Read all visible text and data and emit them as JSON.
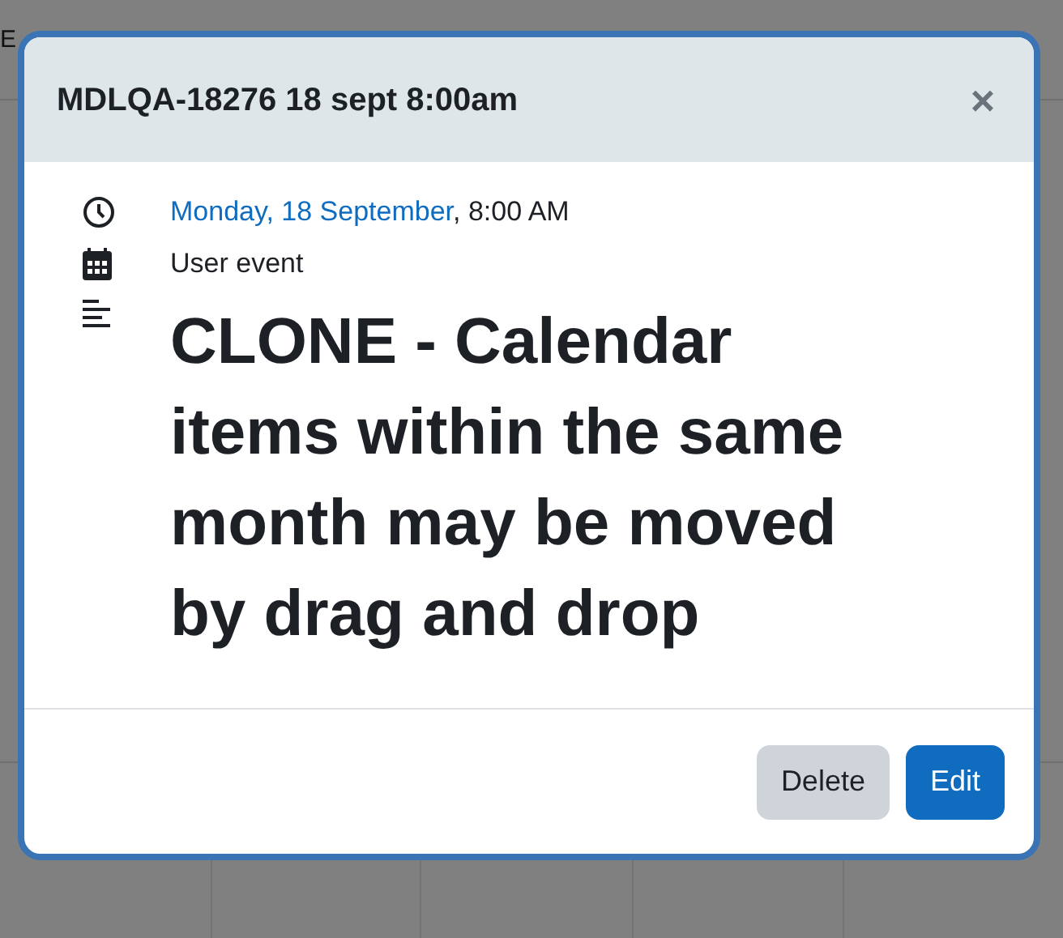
{
  "background": {
    "partial_text": "E"
  },
  "modal": {
    "title": "MDLQA-18276 18 sept 8:00am",
    "close": "×",
    "details": [
      {
        "kind": "date",
        "link": "Monday, 18 September",
        "text": ", 8:00 AM"
      },
      {
        "kind": "event_type",
        "text": "User event"
      },
      {
        "kind": "description",
        "text": "CLONE - Calendar items within the same month may be moved by drag and drop"
      }
    ],
    "buttons": [
      {
        "label": "Delete",
        "kind": "secondary"
      },
      {
        "label": "Edit",
        "kind": "primary"
      }
    ]
  }
}
